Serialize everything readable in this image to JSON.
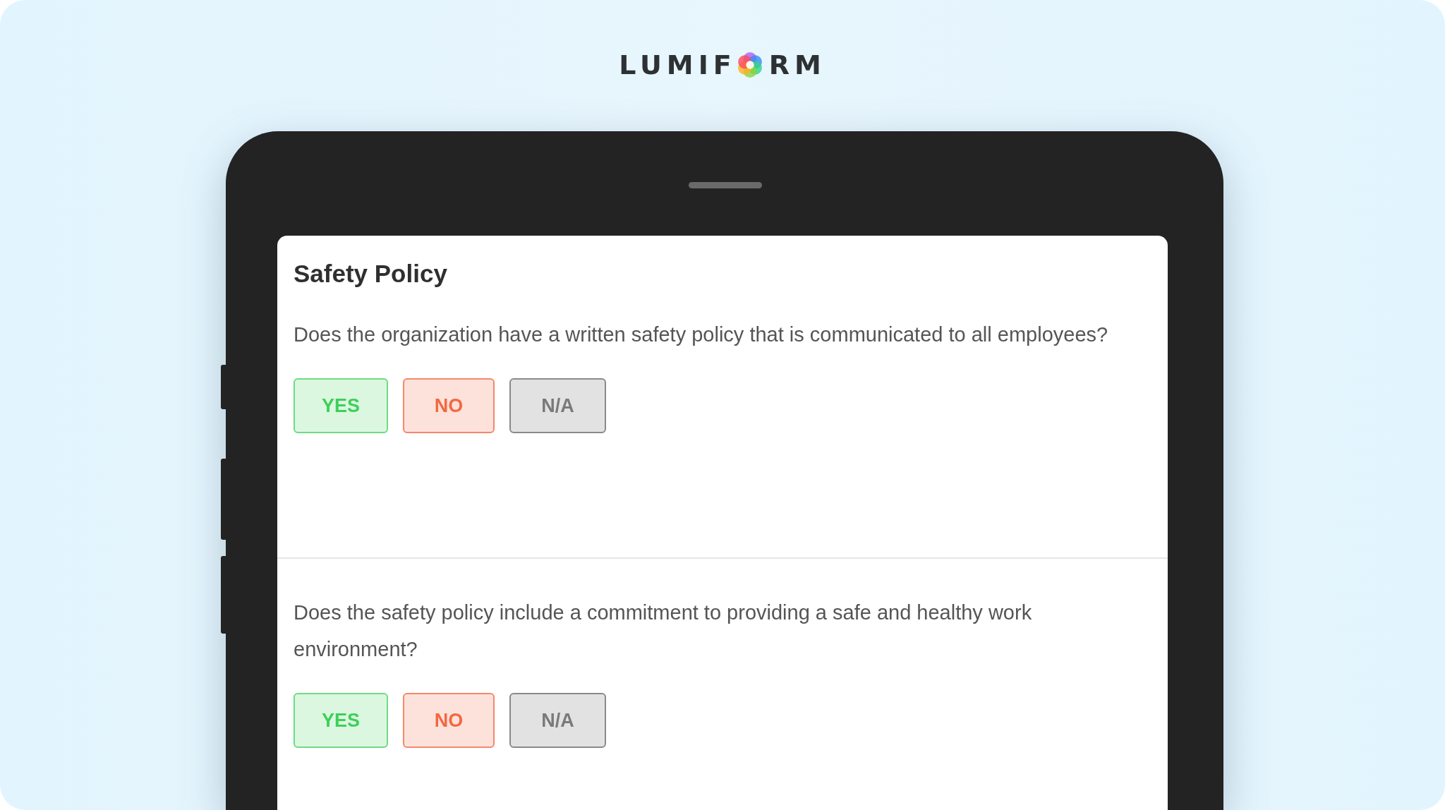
{
  "logo": {
    "before": "LUMIF",
    "after": "RM"
  },
  "form": {
    "title": "Safety Policy",
    "questions": [
      {
        "text": "Does the organization have a written safety policy that is communicated to all employees?",
        "options": [
          {
            "label": "YES",
            "kind": "yes"
          },
          {
            "label": "NO",
            "kind": "no"
          },
          {
            "label": "N/A",
            "kind": "na"
          }
        ]
      },
      {
        "text": "Does the safety policy include a commitment to providing a safe and healthy work environment?",
        "options": [
          {
            "label": "YES",
            "kind": "yes"
          },
          {
            "label": "NO",
            "kind": "no"
          },
          {
            "label": "N/A",
            "kind": "na"
          }
        ]
      }
    ]
  }
}
